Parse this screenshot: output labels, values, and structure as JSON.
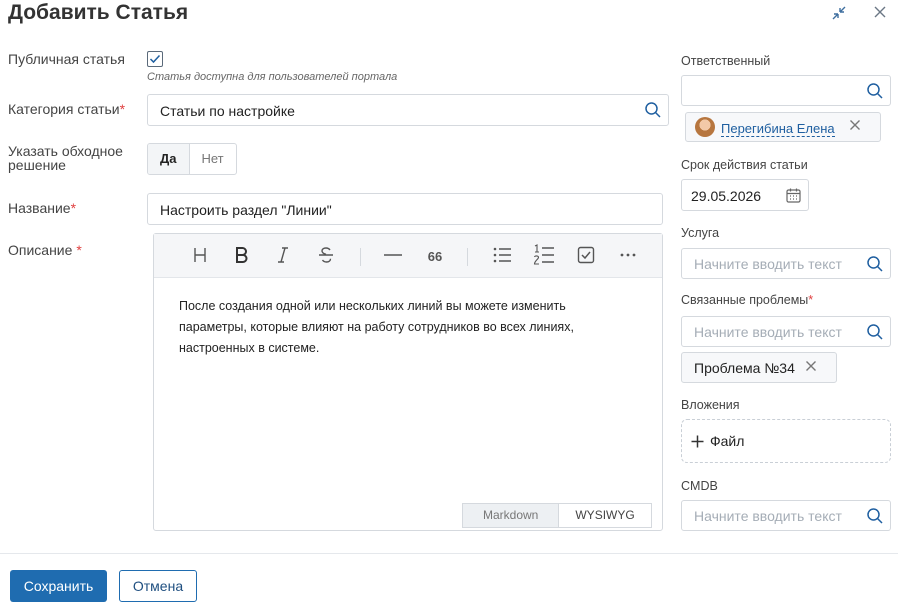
{
  "header": {
    "title": "Добавить Статья"
  },
  "form": {
    "public": {
      "label": "Публичная статья",
      "hint": "Статья доступна для пользователей портала",
      "checked": true
    },
    "category": {
      "label": "Категория статьи",
      "required_mark": "*",
      "value": "Статьи по настройке"
    },
    "workaround": {
      "label_line1": "Указать обходное",
      "label_line2": "решение",
      "yes": "Да",
      "no": "Нет",
      "selected": "Да"
    },
    "name": {
      "label": "Название",
      "required_mark": "*",
      "value": "Настроить раздел \"Линии\""
    },
    "description": {
      "label": "Описание ",
      "required_mark": "*",
      "text": "После создания одной или нескольких линий вы можете изменить параметры, которые влияют на работу сотрудников во всех линиях, настроенных в системе.",
      "mode_markdown": "Markdown",
      "mode_wysiwyg": "WYSIWYG",
      "toolbar_quote": "66"
    }
  },
  "sidebar": {
    "responsible": {
      "label": "Ответственный",
      "search_value": "",
      "person": "Перегибина Елена"
    },
    "validity": {
      "label": "Срок действия статьи",
      "value": "29.05.2026"
    },
    "service": {
      "label": "Услуга",
      "placeholder": "Начните вводить текст"
    },
    "problems": {
      "label": "Связанные проблемы",
      "required_mark": "*",
      "placeholder": "Начните вводить текст",
      "chip": "Проблема №34"
    },
    "attachments": {
      "label": "Вложения",
      "add_label": "Файл"
    },
    "cmdb": {
      "label": "CMDB",
      "placeholder": "Начните вводить текст"
    }
  },
  "footer": {
    "save_label": "Сохранить",
    "cancel_label": "Отмена"
  },
  "colors": {
    "primary": "#1f6cb0",
    "required": "#e04040",
    "link": "#1f5fa0"
  }
}
